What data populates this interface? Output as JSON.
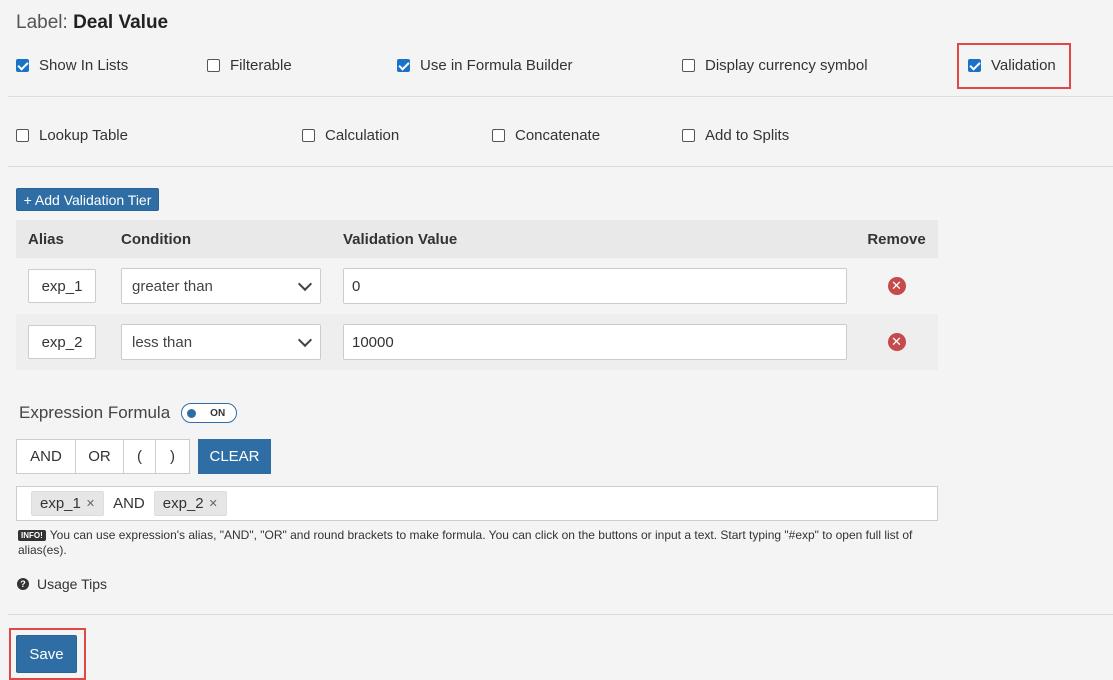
{
  "header": {
    "label_prefix": "Label:",
    "label_value": "Deal Value"
  },
  "options_row1": [
    {
      "label": "Show In Lists",
      "checked": true
    },
    {
      "label": "Filterable",
      "checked": false
    },
    {
      "label": "Use in Formula Builder",
      "checked": true
    },
    {
      "label": "Display currency symbol",
      "checked": false
    },
    {
      "label": "Validation",
      "checked": true
    }
  ],
  "options_row2": [
    {
      "label": "Lookup Table",
      "checked": false
    },
    {
      "label": "Calculation",
      "checked": false
    },
    {
      "label": "Concatenate",
      "checked": false
    },
    {
      "label": "Add to Splits",
      "checked": false
    }
  ],
  "validation": {
    "add_tier_label": "+ Add Validation Tier",
    "columns": {
      "alias": "Alias",
      "condition": "Condition",
      "value": "Validation Value",
      "remove": "Remove"
    },
    "rows": [
      {
        "alias": "exp_1",
        "condition": "greater than",
        "value": "0"
      },
      {
        "alias": "exp_2",
        "condition": "less than",
        "value": "10000"
      }
    ]
  },
  "expression": {
    "title": "Expression Formula",
    "toggle_label": "ON",
    "operators": [
      "AND",
      "OR",
      "(",
      ")"
    ],
    "clear_label": "CLEAR",
    "tokens": {
      "first": "exp_1",
      "op": "AND",
      "second": "exp_2"
    },
    "info_badge": "INFO!",
    "info_text": "You can use expression's alias, \"AND\", \"OR\" and round brackets to make formula. You can click on the buttons or input a text. Start typing \"#exp\" to open full list of alias(es).",
    "usage_tips": "Usage Tips"
  },
  "save_label": "Save",
  "colors": {
    "primary": "#2f6ea5",
    "highlight": "#e04848",
    "remove": "#c64a4a"
  }
}
